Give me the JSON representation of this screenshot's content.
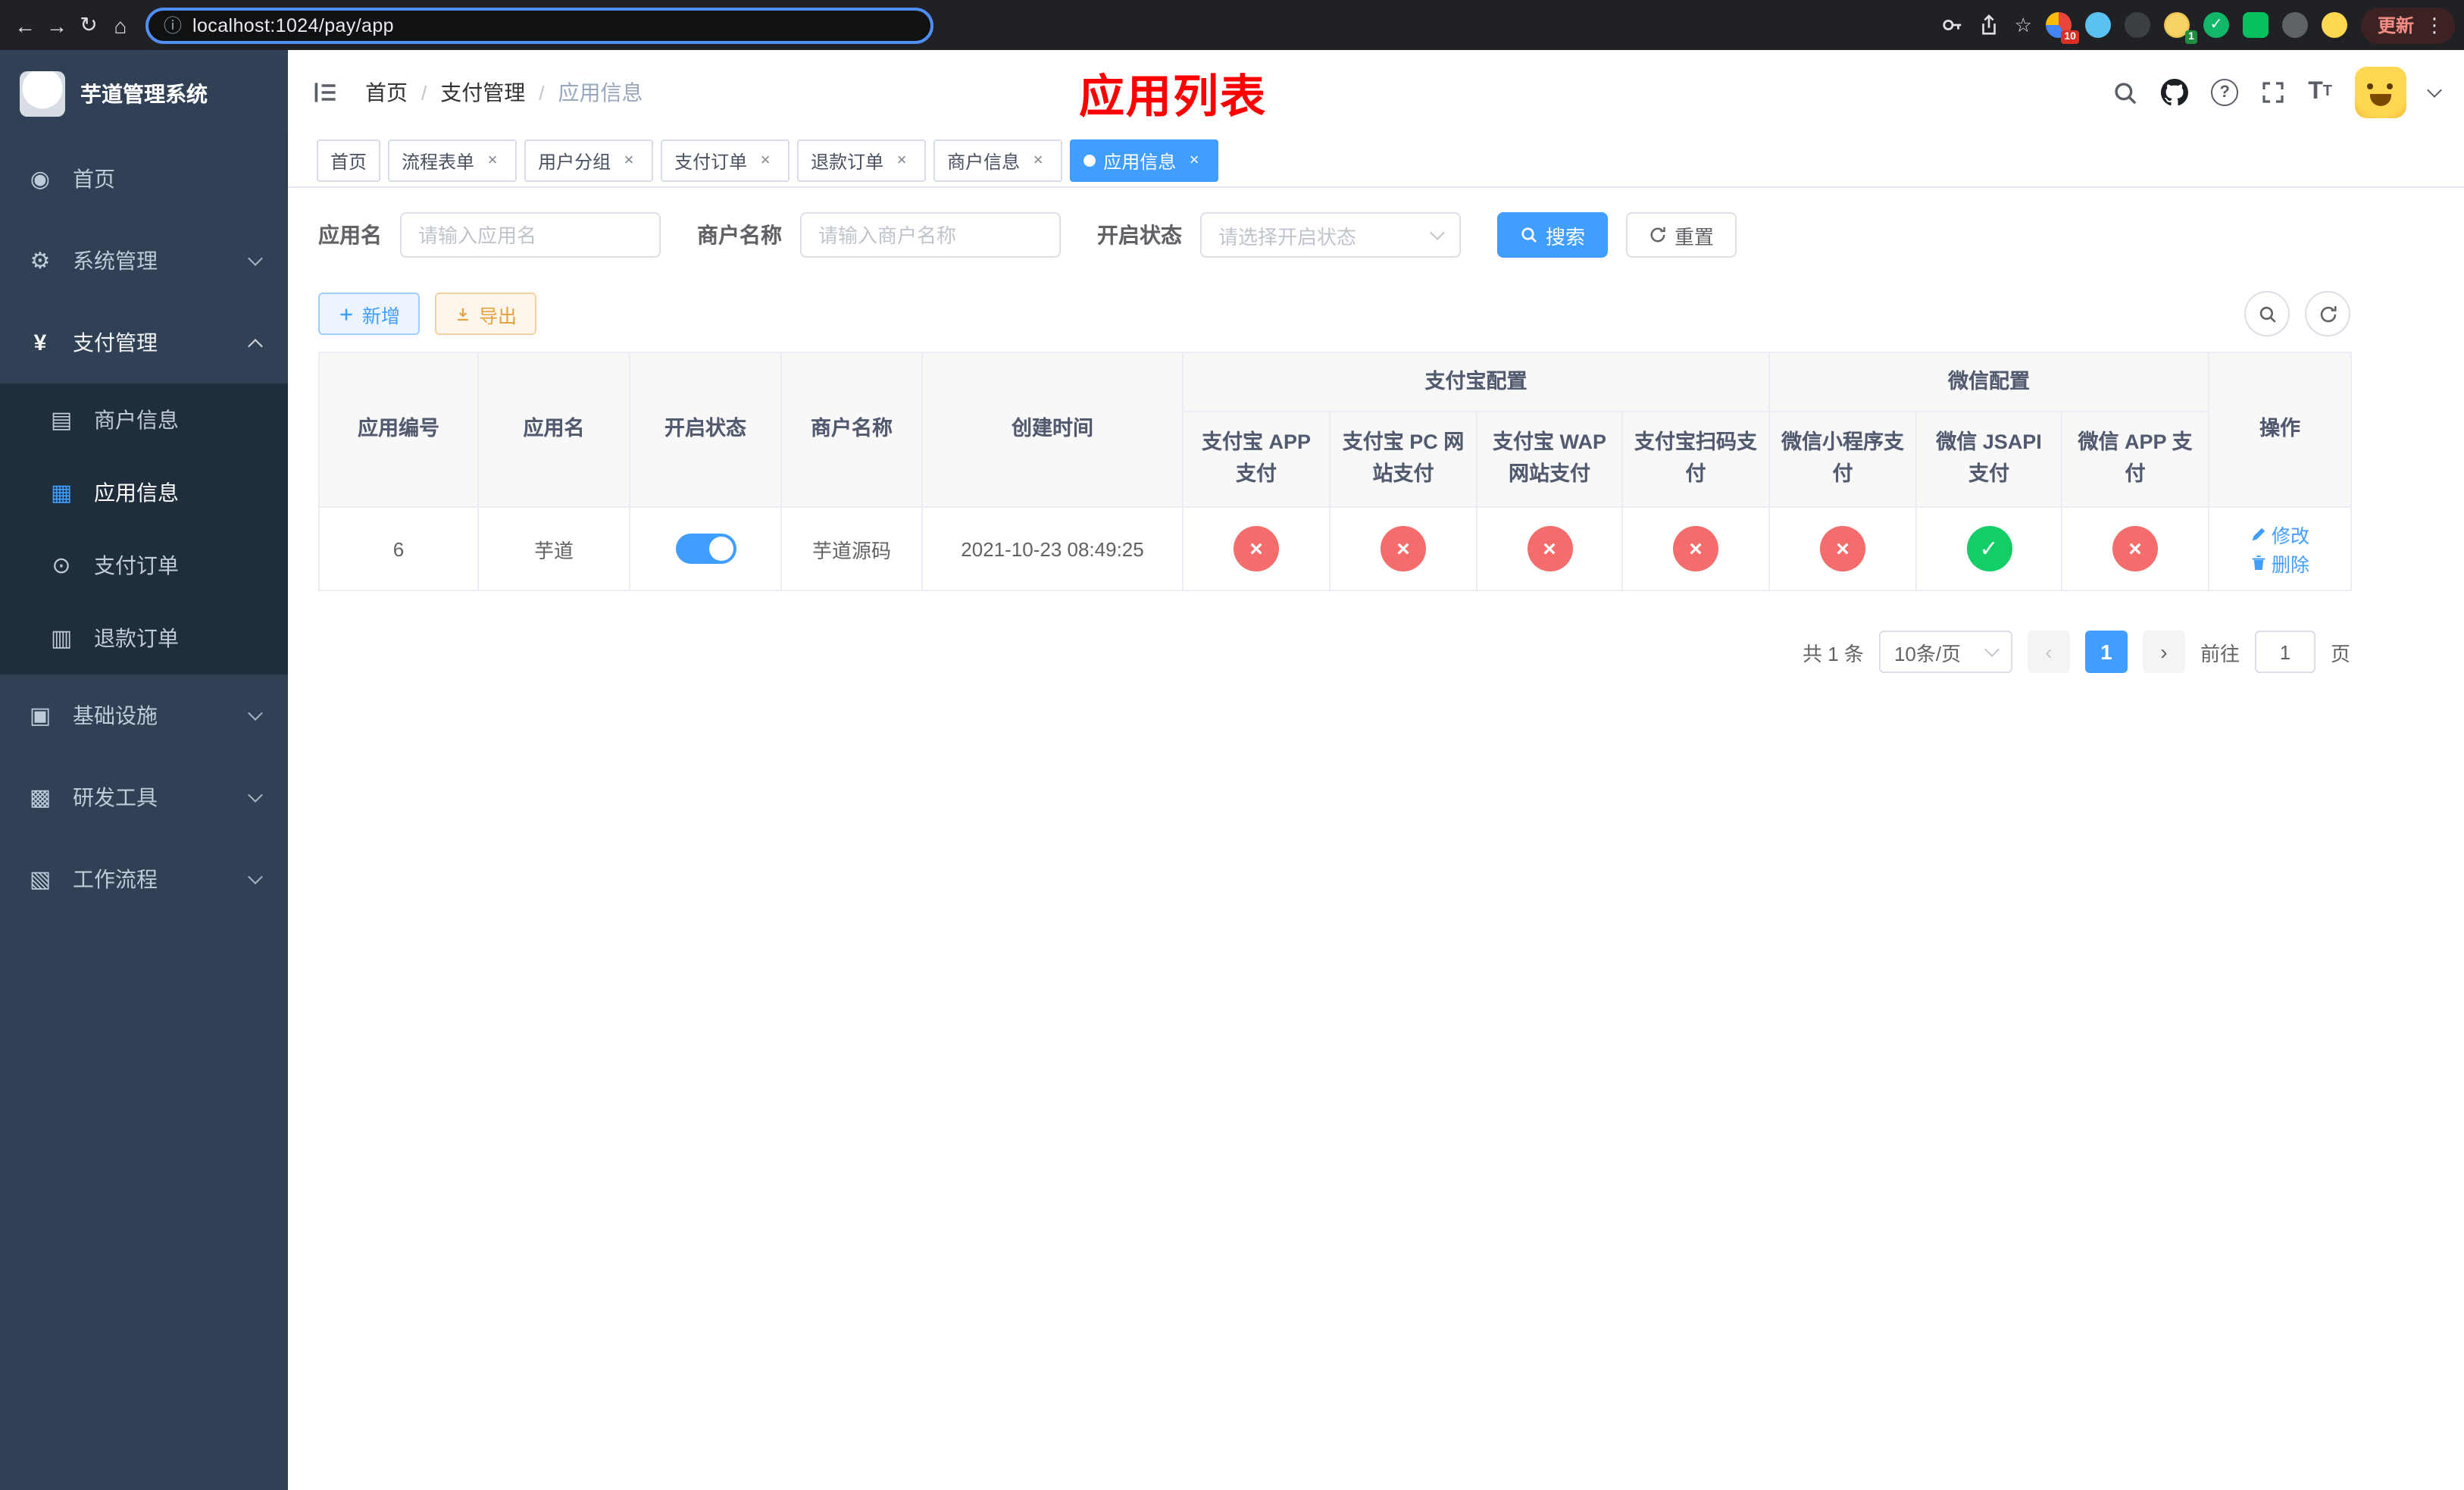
{
  "browser": {
    "url": "localhost:1024/pay/app",
    "update_label": "更新",
    "ext_badge_1": "10",
    "ext_badge_2": "1"
  },
  "sidebar": {
    "app_title": "芋道管理系统",
    "items": [
      {
        "label": "首页"
      },
      {
        "label": "系统管理"
      },
      {
        "label": "支付管理"
      },
      {
        "label": "基础设施"
      },
      {
        "label": "研发工具"
      },
      {
        "label": "工作流程"
      }
    ],
    "pay_children": [
      {
        "label": "商户信息"
      },
      {
        "label": "应用信息"
      },
      {
        "label": "支付订单"
      },
      {
        "label": "退款订单"
      }
    ]
  },
  "header": {
    "breadcrumb": [
      "首页",
      "支付管理",
      "应用信息"
    ],
    "page_title": "应用列表"
  },
  "tabs": [
    {
      "label": "首页"
    },
    {
      "label": "流程表单"
    },
    {
      "label": "用户分组"
    },
    {
      "label": "支付订单"
    },
    {
      "label": "退款订单"
    },
    {
      "label": "商户信息"
    },
    {
      "label": "应用信息"
    }
  ],
  "filters": {
    "app_name_label": "应用名",
    "app_name_placeholder": "请输入应用名",
    "merchant_label": "商户名称",
    "merchant_placeholder": "请输入商户名称",
    "status_label": "开启状态",
    "status_placeholder": "请选择开启状态",
    "search_button": "搜索",
    "reset_button": "重置"
  },
  "toolbar": {
    "add_button": "新增",
    "export_button": "导出"
  },
  "table": {
    "group_headers": {
      "alipay": "支付宝配置",
      "wechat": "微信配置"
    },
    "columns": [
      "应用编号",
      "应用名",
      "开启状态",
      "商户名称",
      "创建时间",
      "支付宝 APP 支付",
      "支付宝 PC 网站支付",
      "支付宝 WAP 网站支付",
      "支付宝扫码支付",
      "微信小程序支付",
      "微信 JSAPI 支付",
      "微信 APP 支付",
      "操作"
    ],
    "rows": [
      {
        "id": "6",
        "name": "芋道",
        "enabled": true,
        "merchant": "芋道源码",
        "created": "2021-10-23 08:49:25",
        "configs": [
          "no",
          "no",
          "no",
          "no",
          "no",
          "yes",
          "no"
        ],
        "edit_label": "修改",
        "delete_label": "删除"
      }
    ]
  },
  "pagination": {
    "total": "共 1 条",
    "page_size": "10条/页",
    "current_page": "1",
    "goto_label": "前往",
    "goto_value": "1",
    "page_suffix": "页"
  },
  "colors": {
    "primary": "#409eff",
    "success": "#13ce66",
    "danger": "#f56c6c",
    "warning": "#e6a23c",
    "title_red": "#ff0000",
    "sidebar_bg": "#304156",
    "submenu_bg": "#1f2d3d"
  }
}
